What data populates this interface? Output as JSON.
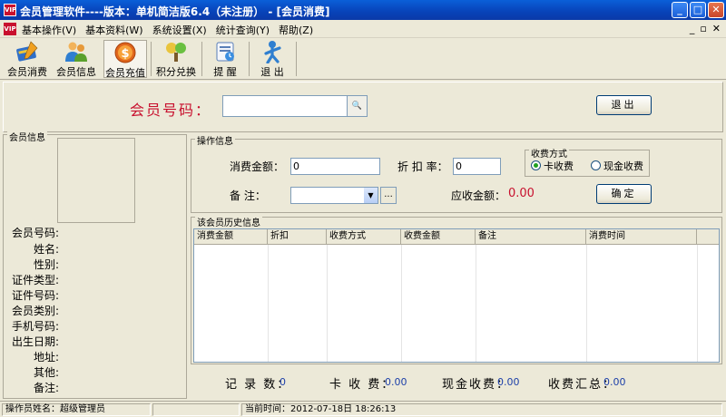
{
  "window": {
    "title": "会员管理软件----版本：单机简洁版6.4（未注册） - [会员消费]",
    "app_icon": "VIP",
    "buttons": [
      "_",
      "□",
      "✕"
    ]
  },
  "menu": {
    "items": [
      "基本操作(V)",
      "基本资料(W)",
      "系统设置(X)",
      "统计查询(Y)",
      "帮助(Z)"
    ],
    "mdi_buttons": [
      "_",
      "▫",
      "✕"
    ]
  },
  "toolbar": {
    "buttons": [
      {
        "label": "会员消费",
        "icon": "card-pen-icon"
      },
      {
        "label": "会员信息",
        "icon": "users-icon"
      },
      {
        "label": "会员充值",
        "icon": "coin-icon"
      },
      {
        "label": "积分兑换",
        "icon": "gift-icon"
      },
      {
        "label": "提 醒",
        "icon": "reminder-icon"
      },
      {
        "label": "退 出",
        "icon": "exit-person-icon"
      }
    ]
  },
  "search": {
    "member_no_label": "会员号码：",
    "member_no_value": "",
    "lookup_glyph": "🔍",
    "exit_label": "退出"
  },
  "member_info": {
    "title": "会员信息",
    "fields": [
      "会员号码:",
      "姓名:",
      "性别:",
      "证件类型:",
      "证件号码:",
      "会员类别:",
      "手机号码:",
      "出生日期:",
      "地址:",
      "其他:",
      "备注:"
    ]
  },
  "operation": {
    "title": "操作信息",
    "amount_label": "消费金额：",
    "amount_value": "0",
    "discount_label": "折 扣 率：",
    "discount_value": "0",
    "remark_label": "备    注：",
    "remark_value": "",
    "ellipsis": "...",
    "receivable_label": "应收金额：",
    "receivable_value": "0.00",
    "confirm_label": "确定",
    "pay_method": {
      "title": "收费方式",
      "options": [
        "卡收费",
        "现金收费"
      ],
      "selected": 0
    }
  },
  "history": {
    "title": "该会员历史信息",
    "columns": [
      "消费金额",
      "折扣",
      "收费方式",
      "收费金额",
      "备注",
      "消费时间"
    ]
  },
  "summary": {
    "record_label": "记 录 数：",
    "record_value": "0",
    "card_label": "卡 收 费：",
    "card_value": "0.00",
    "cash_label": "现金收费：",
    "cash_value": "0.00",
    "total_label": "收费汇总：",
    "total_value": "0.00"
  },
  "status": {
    "operator": "操作员姓名：超级管理员",
    "current_time": "当前时间：2012-07-18日 18:26:13"
  }
}
